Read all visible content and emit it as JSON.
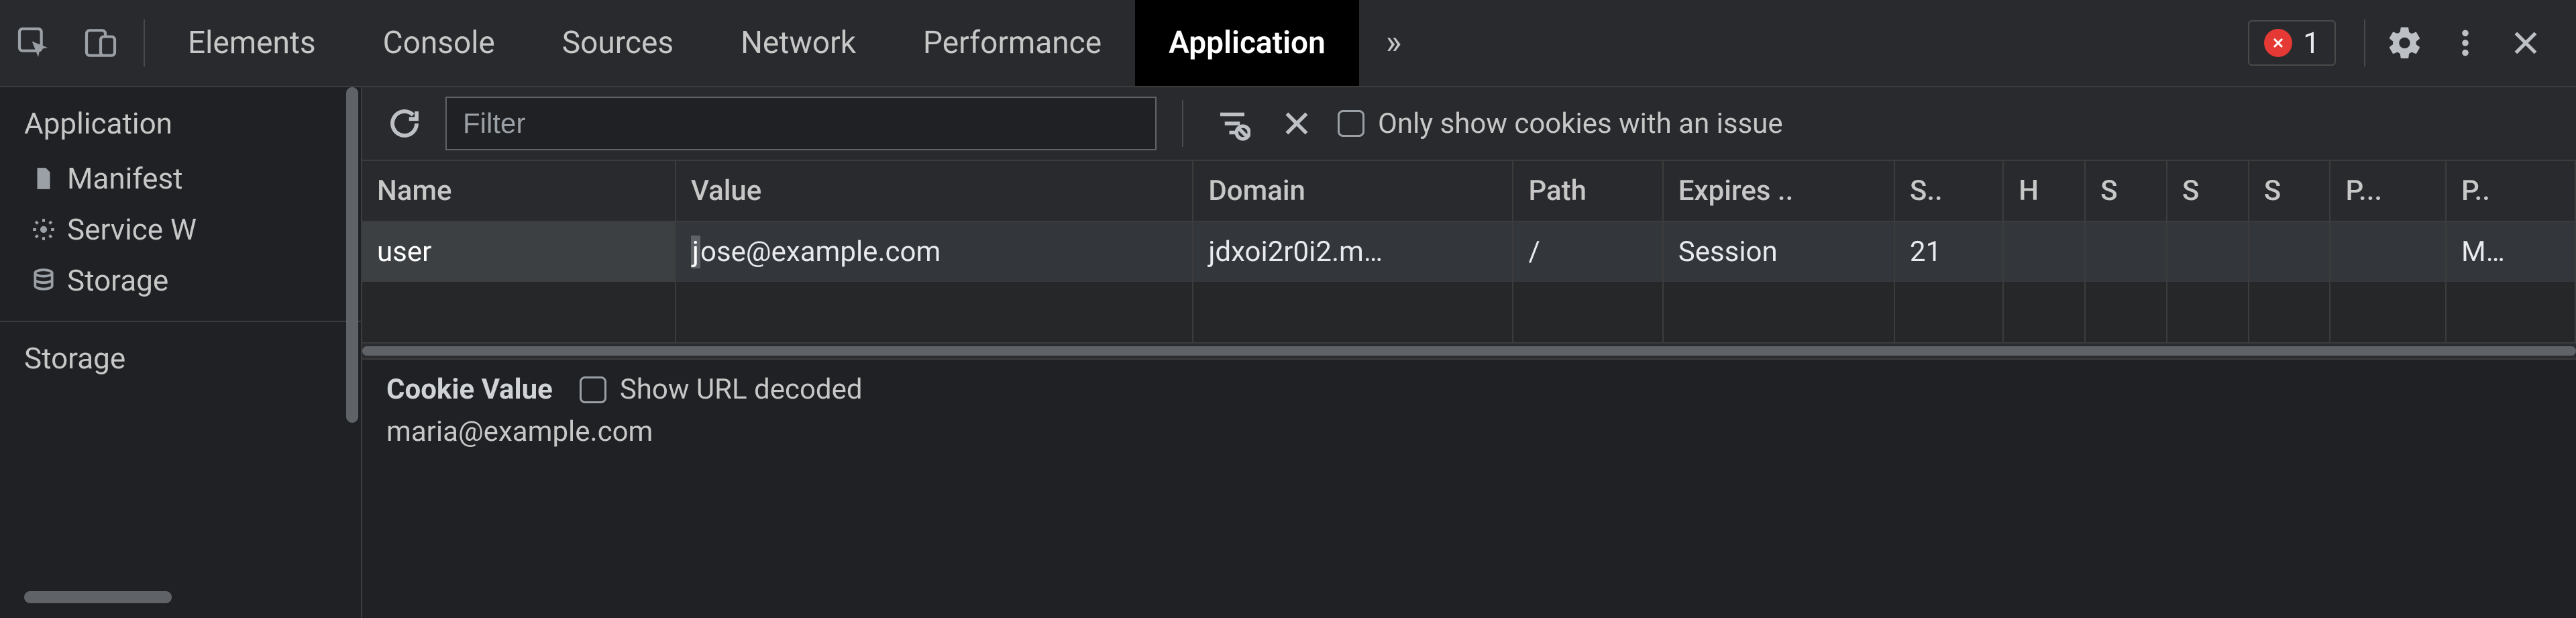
{
  "top": {
    "tabs": [
      "Elements",
      "Console",
      "Sources",
      "Network",
      "Performance",
      "Application"
    ],
    "active_index": 5,
    "more_glyph": "»",
    "errors_count": "1"
  },
  "sidebar": {
    "sections": [
      {
        "title": "Application",
        "items": [
          {
            "label": "Manifest",
            "icon": "file-icon"
          },
          {
            "label": "Service W",
            "icon": "gear-icon"
          },
          {
            "label": "Storage",
            "icon": "database-icon"
          }
        ]
      },
      {
        "title": "Storage",
        "items": []
      }
    ]
  },
  "toolbar": {
    "filter_placeholder": "Filter",
    "issue_label": "Only show cookies with an issue"
  },
  "cookies": {
    "columns": [
      "Name",
      "Value",
      "Domain",
      "Path",
      "Expires ..",
      "S..",
      "H",
      "S",
      "S",
      "S",
      "P...",
      "P.."
    ],
    "rows": [
      {
        "name": "user",
        "value_hl": "j",
        "value_rest": "ose@example.com",
        "domain": "jdxoi2r0i2.m…",
        "path": "/",
        "expires": "Session",
        "size": "21",
        "h": "",
        "s1": "",
        "s2": "",
        "s3": "",
        "p1": "",
        "p2": "M…"
      }
    ]
  },
  "details": {
    "label": "Cookie Value",
    "decode_label": "Show URL decoded",
    "value": "maria@example.com"
  }
}
